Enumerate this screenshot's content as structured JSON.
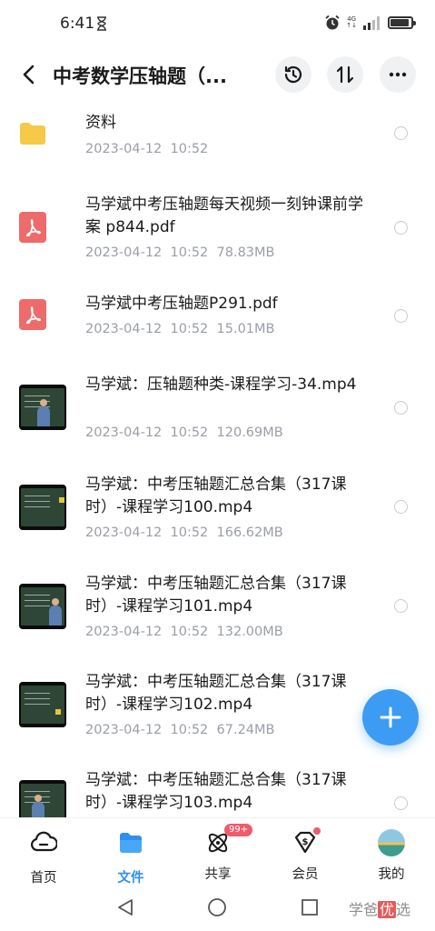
{
  "status": {
    "time": "6:41",
    "network": "4G"
  },
  "header": {
    "title": "中考数学压轴题（..."
  },
  "files": [
    {
      "type": "folder",
      "name": "资料",
      "date": "2023-04-12",
      "time": "10:52",
      "size": ""
    },
    {
      "type": "pdf",
      "name": "马学斌中考压轴题每天视频一刻钟课前学案 p844.pdf",
      "date": "2023-04-12",
      "time": "10:52",
      "size": "78.83MB"
    },
    {
      "type": "pdf",
      "name": "马学斌中考压轴题P291.pdf",
      "date": "2023-04-12",
      "time": "10:52",
      "size": "15.01MB"
    },
    {
      "type": "video",
      "name": "马学斌：压轴题种类-课程学习-34.mp4",
      "date": "2023-04-12",
      "time": "10:52",
      "size": "120.69MB"
    },
    {
      "type": "video",
      "name": "马学斌：中考压轴题汇总合集（317课时）-课程学习100.mp4",
      "date": "2023-04-12",
      "time": "10:52",
      "size": "166.62MB"
    },
    {
      "type": "video",
      "name": "马学斌：中考压轴题汇总合集（317课时）-课程学习101.mp4",
      "date": "2023-04-12",
      "time": "10:52",
      "size": "132.00MB"
    },
    {
      "type": "video",
      "name": "马学斌：中考压轴题汇总合集（317课时）-课程学习102.mp4",
      "date": "2023-04-12",
      "time": "10:52",
      "size": "67.24MB"
    },
    {
      "type": "video",
      "name": "马学斌：中考压轴题汇总合集（317课时）-课程学习103.mp4",
      "date": "",
      "time": "",
      "size": ""
    }
  ],
  "nav": {
    "home": "首页",
    "files": "文件",
    "share": "共享",
    "share_badge": "99+",
    "vip": "会员",
    "mine": "我的"
  },
  "watermark": {
    "a": "学爸",
    "b": "优",
    "c": "选"
  },
  "colors": {
    "accent": "#3c9bf2",
    "pdf": "#ee6b6b",
    "folder": "#f7c948",
    "badge": "#f05b6b"
  }
}
